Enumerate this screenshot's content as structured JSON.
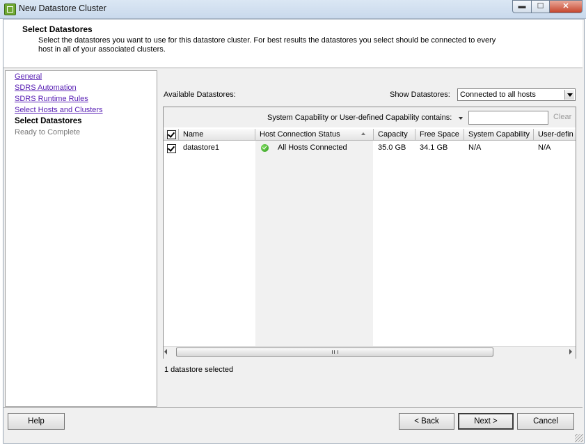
{
  "window": {
    "title": "New Datastore Cluster",
    "controls": {
      "minimize": "▬",
      "maximize": "☐",
      "close": "✕"
    }
  },
  "header": {
    "title": "Select Datastores",
    "description": "Select the datastores you want to use for this datastore cluster. For best results the datastores you select should be connected to every host in all of your associated clusters."
  },
  "nav": {
    "items": [
      {
        "label": "General",
        "state": "link"
      },
      {
        "label": "SDRS Automation",
        "state": "link"
      },
      {
        "label": "SDRS Runtime Rules",
        "state": "link"
      },
      {
        "label": "Select Hosts and Clusters",
        "state": "link"
      },
      {
        "label": "Select Datastores",
        "state": "current"
      },
      {
        "label": "Ready to Complete",
        "state": "disabled"
      }
    ]
  },
  "main": {
    "available_label": "Available Datastores:",
    "show_label": "Show Datastores:",
    "show_value": "Connected to all hosts",
    "filter_label": "System Capability or User-defined Capability contains:",
    "filter_value": "",
    "clear_label": "Clear",
    "columns": [
      "Name",
      "Host Connection Status",
      "Capacity",
      "Free Space",
      "System Capability",
      "User-defin"
    ],
    "sorted_column": "Host Connection Status",
    "rows": [
      {
        "checked": true,
        "name": "datastore1",
        "status_icon": "ok-check-icon",
        "status": "All Hosts Connected",
        "capacity": "35.0 GB",
        "free_space": "34.1 GB",
        "system_capability": "N/A",
        "user_defined": "N/A"
      }
    ],
    "selection_summary": "1 datastore selected"
  },
  "footer": {
    "help": "Help",
    "back": "< Back",
    "next": "Next >",
    "cancel": "Cancel"
  },
  "colors": {
    "link": "#5a21b5",
    "status_ok": "#2c9a1a",
    "sorted_column_bg": "#f1f1f1"
  }
}
